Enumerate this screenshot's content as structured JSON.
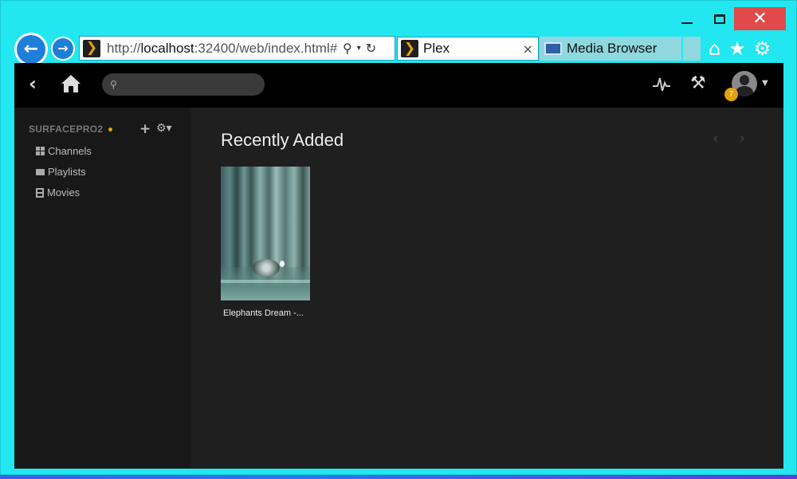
{
  "browser": {
    "url_prefix": "http://",
    "url_host": "localhost",
    "url_rest": ":32400/web/index.html#",
    "tabs": [
      {
        "title": "Plex",
        "close": "×"
      },
      {
        "title": "Media Browser"
      }
    ],
    "window_close": "✕"
  },
  "plex": {
    "server_name": "SURFACEPRO2",
    "notification_count": "7",
    "sidebar_items": [
      {
        "label": "Channels",
        "icon": "grid-icon"
      },
      {
        "label": "Playlists",
        "icon": "playlist-icon"
      },
      {
        "label": "Movies",
        "icon": "film-icon"
      }
    ],
    "section_title": "Recently Added",
    "items": [
      {
        "caption": "Elephants Dream -..."
      }
    ],
    "search_placeholder": ""
  },
  "colors": {
    "window_frame": "#22e7f0",
    "plex_accent": "#e5a00d",
    "close_button": "#e04a4a",
    "browser_button": "#1f7fd8"
  }
}
